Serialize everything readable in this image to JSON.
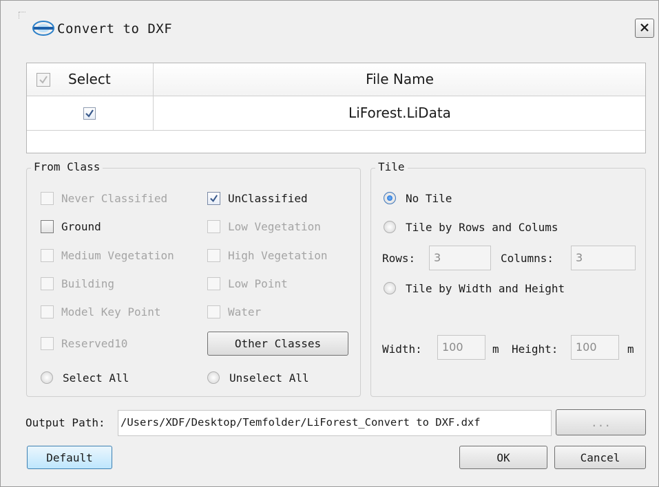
{
  "window": {
    "title": "Convert to DXF",
    "close_label": "×",
    "logo_icon": "liforest-logo-icon"
  },
  "file_table": {
    "columns": [
      "Select",
      "File Name"
    ],
    "rows": [
      {
        "selected": true,
        "file_name": "LiForest.LiData"
      }
    ]
  },
  "from_class": {
    "title": "From Class",
    "classes": [
      {
        "label": "Never Classified",
        "checked": false,
        "enabled": false
      },
      {
        "label": "UnClassified",
        "checked": true,
        "enabled": true
      },
      {
        "label": "Ground",
        "checked": false,
        "enabled": true
      },
      {
        "label": "Low Vegetation",
        "checked": false,
        "enabled": false
      },
      {
        "label": "Medium Vegetation",
        "checked": false,
        "enabled": false
      },
      {
        "label": "High Vegetation",
        "checked": false,
        "enabled": false
      },
      {
        "label": "Building",
        "checked": false,
        "enabled": false
      },
      {
        "label": "Low Point",
        "checked": false,
        "enabled": false
      },
      {
        "label": "Model Key Point",
        "checked": false,
        "enabled": false
      },
      {
        "label": "Water",
        "checked": false,
        "enabled": false
      },
      {
        "label": "Reserved10",
        "checked": false,
        "enabled": false
      }
    ],
    "other_classes_label": "Other Classes",
    "select_all_label": "Select All",
    "unselect_all_label": "Unselect All"
  },
  "tile": {
    "title": "Tile",
    "options": [
      {
        "label": "No Tile",
        "selected": true
      },
      {
        "label": "Tile by Rows and Colums",
        "selected": false
      },
      {
        "label": "Tile by Width and Height",
        "selected": false
      }
    ],
    "rows_label": "Rows:",
    "rows_value": "3",
    "columns_label": "Columns:",
    "columns_value": "3",
    "width_label": "Width:",
    "width_value": "100",
    "width_unit": "m",
    "height_label": "Height:",
    "height_value": "100",
    "height_unit": "m"
  },
  "output": {
    "label": "Output Path:",
    "path": "/Users/XDF/Desktop/Temfolder/LiForest_Convert to DXF.dxf",
    "browse_label": "..."
  },
  "buttons": {
    "default_label": "Default",
    "ok_label": "OK",
    "cancel_label": "Cancel"
  },
  "colors": {
    "accent": "#3c7fb1",
    "dialog_bg": "#f0f0f0",
    "radio_selected": "#1b63c6"
  }
}
